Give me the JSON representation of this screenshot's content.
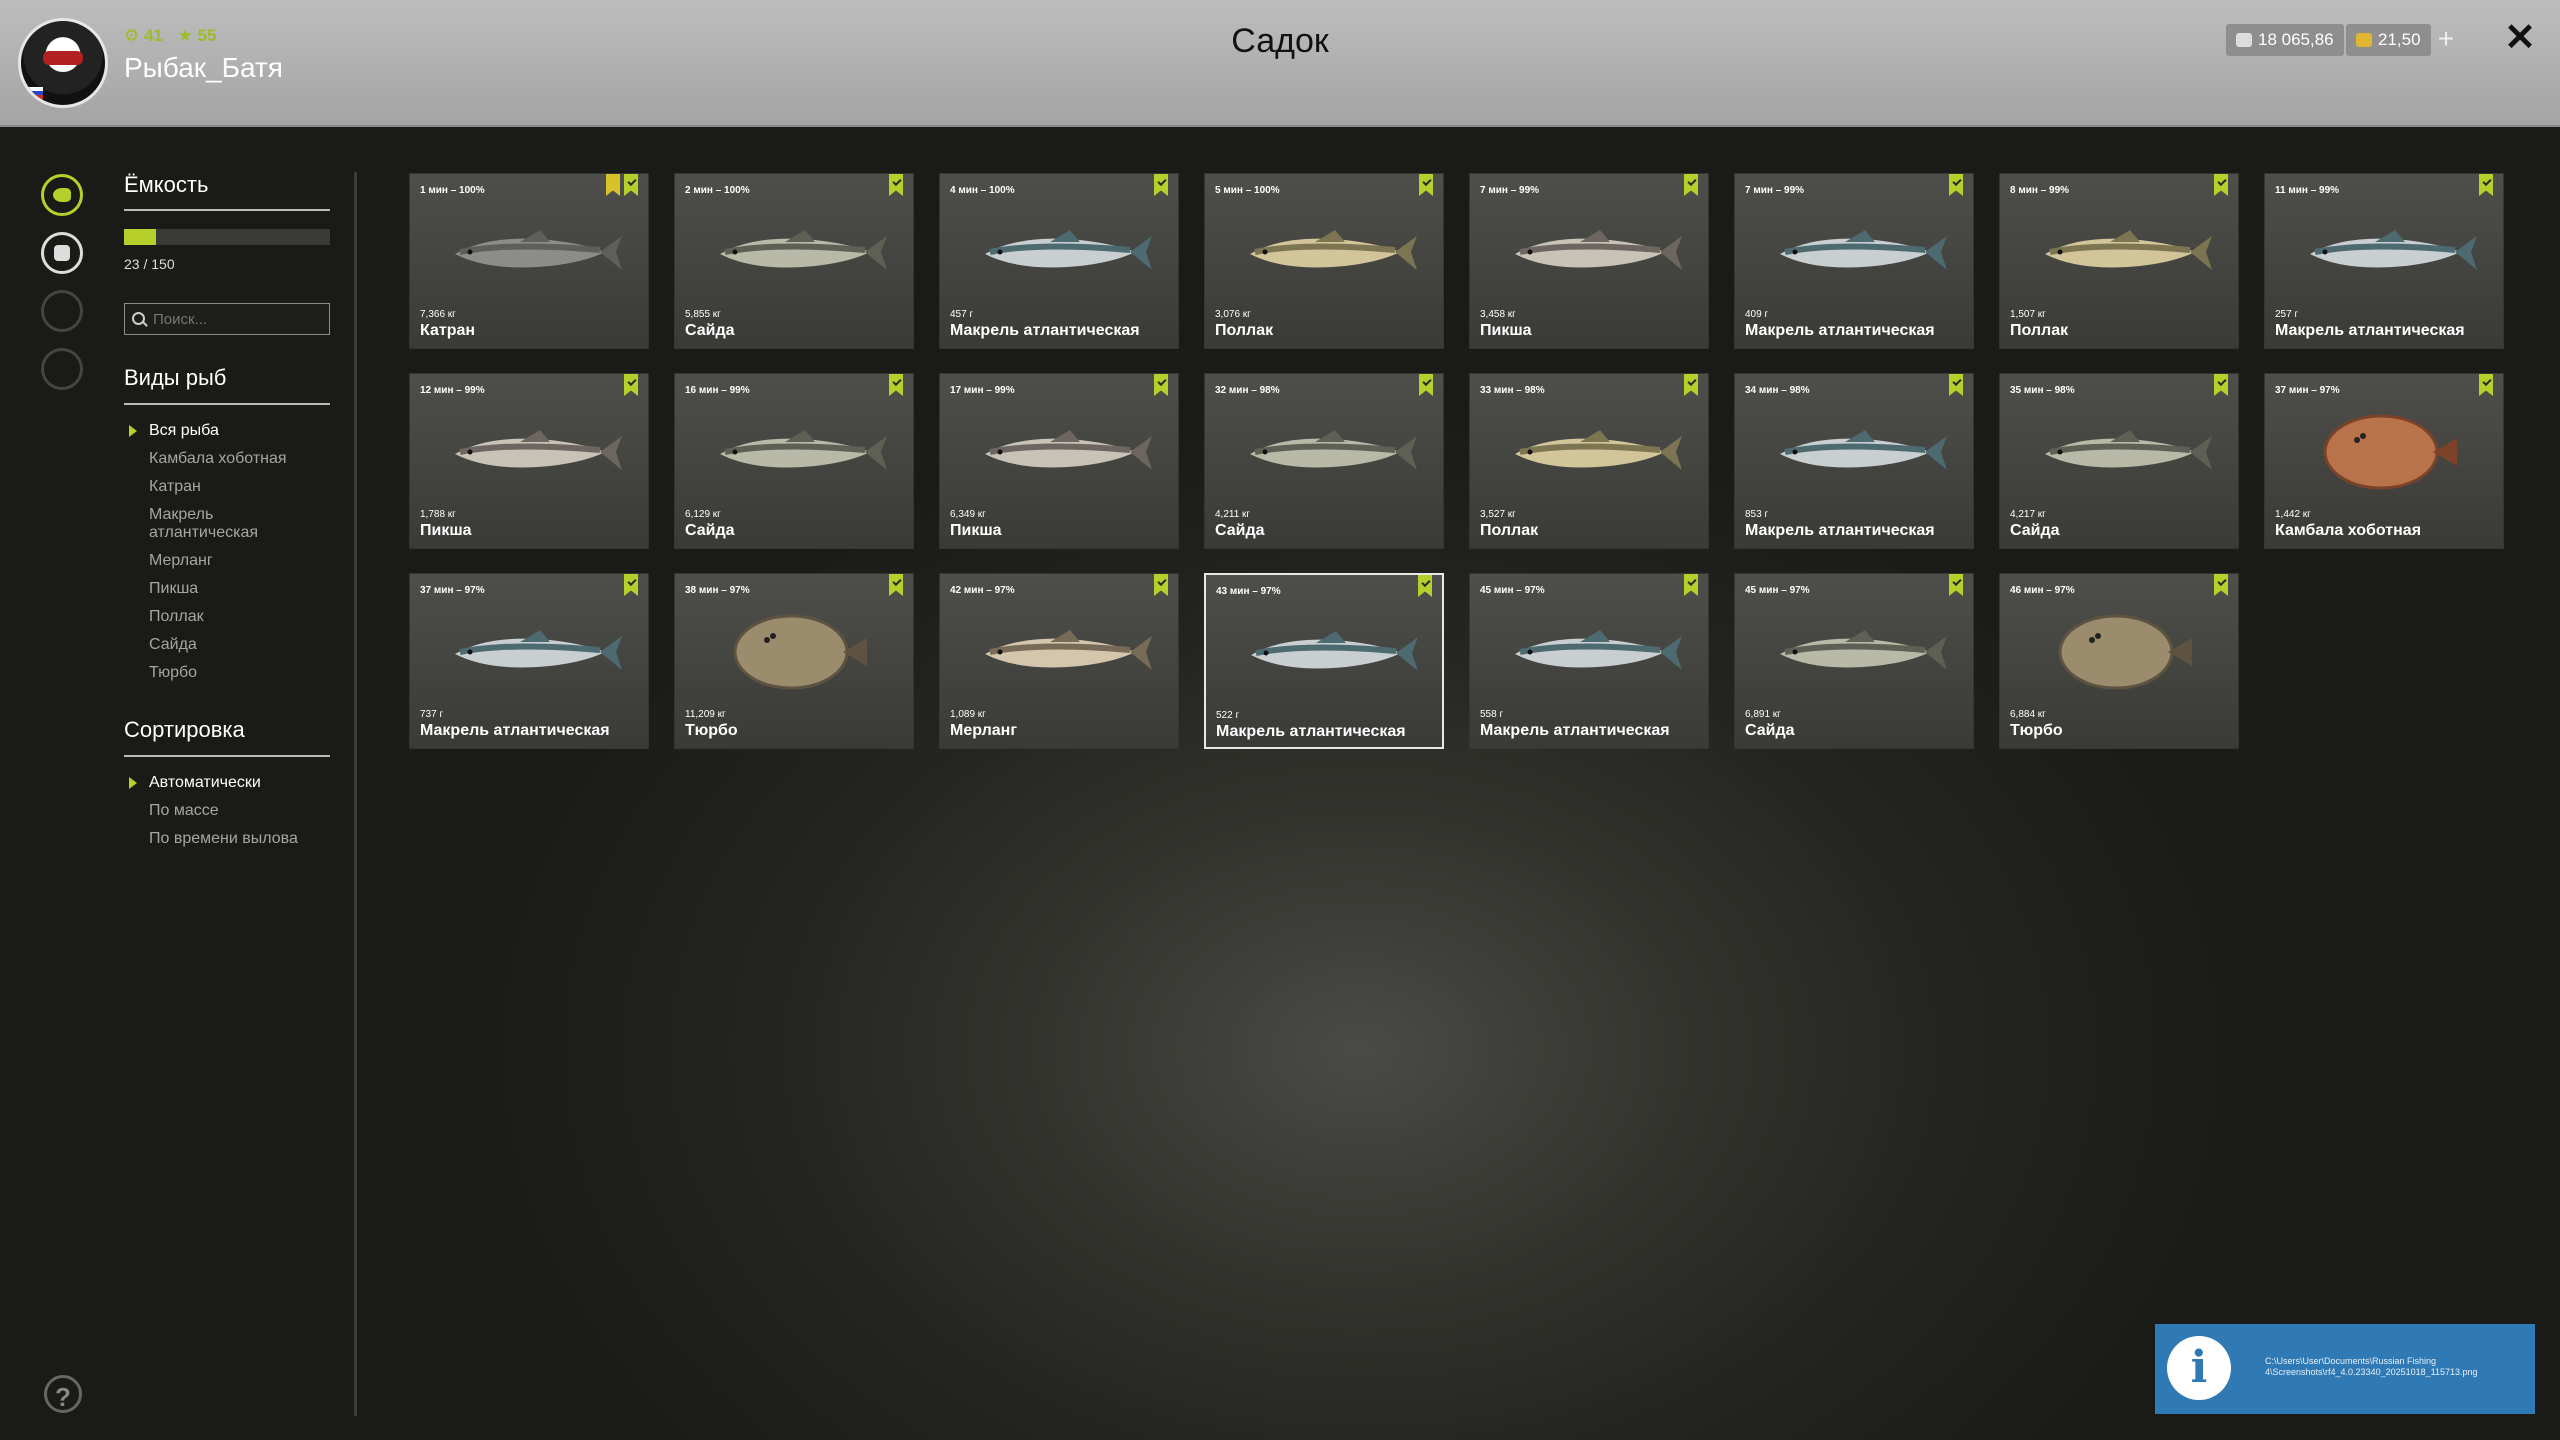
{
  "header": {
    "title": "Садок",
    "player": {
      "name": "Рыбак_Батя",
      "level": "41",
      "rating": "55"
    },
    "currency": {
      "silver": "18 065,86",
      "gold": "21,50"
    }
  },
  "sidebar": {
    "icons": [
      "fish-keepnet-icon",
      "inventory-icon",
      "fire-icon",
      "home-icon"
    ]
  },
  "capacity": {
    "title": "Ёмкость",
    "text": "23 / 150",
    "fill": 0.153
  },
  "search": {
    "placeholder": "Поиск..."
  },
  "species": {
    "title": "Виды рыб",
    "items": [
      "Вся рыба",
      "Камбала хоботная",
      "Катран",
      "Макрель атлантическая",
      "Мерланг",
      "Пикша",
      "Поллак",
      "Сайда",
      "Тюрбо"
    ],
    "selected": 0
  },
  "sorting": {
    "title": "Сортировка",
    "items": [
      "Автоматически",
      "По массе",
      "По времени вылова"
    ],
    "selected": 0
  },
  "fish": [
    {
      "meta": "1 мин – 100%",
      "weight": "7,366 кг",
      "name": "Катран",
      "kind": "shark",
      "star": true
    },
    {
      "meta": "2 мин – 100%",
      "weight": "5,855 кг",
      "name": "Сайда",
      "kind": "cod"
    },
    {
      "meta": "4 мин – 100%",
      "weight": "457 г",
      "name": "Макрель атлантическая",
      "kind": "mackerel"
    },
    {
      "meta": "5 мин – 100%",
      "weight": "3,076 кг",
      "name": "Поллак",
      "kind": "pollack"
    },
    {
      "meta": "7 мин – 99%",
      "weight": "3,458 кг",
      "name": "Пикша",
      "kind": "haddock"
    },
    {
      "meta": "7 мин – 99%",
      "weight": "409 г",
      "name": "Макрель атлантическая",
      "kind": "mackerel"
    },
    {
      "meta": "8 мин – 99%",
      "weight": "1,507 кг",
      "name": "Поллак",
      "kind": "pollack"
    },
    {
      "meta": "11 мин – 99%",
      "weight": "257 г",
      "name": "Макрель атлантическая",
      "kind": "mackerel"
    },
    {
      "meta": "12 мин – 99%",
      "weight": "1,788 кг",
      "name": "Пикша",
      "kind": "haddock"
    },
    {
      "meta": "16 мин – 99%",
      "weight": "6,129 кг",
      "name": "Сайда",
      "kind": "cod"
    },
    {
      "meta": "17 мин – 99%",
      "weight": "6,349 кг",
      "name": "Пикша",
      "kind": "haddock"
    },
    {
      "meta": "32 мин – 98%",
      "weight": "4,211 кг",
      "name": "Сайда",
      "kind": "cod"
    },
    {
      "meta": "33 мин – 98%",
      "weight": "3,527 кг",
      "name": "Поллак",
      "kind": "pollack"
    },
    {
      "meta": "34 мин – 98%",
      "weight": "853 г",
      "name": "Макрель атлантическая",
      "kind": "mackerel"
    },
    {
      "meta": "35 мин – 98%",
      "weight": "4,217 кг",
      "name": "Сайда",
      "kind": "cod"
    },
    {
      "meta": "37 мин – 97%",
      "weight": "1,442 кг",
      "name": "Камбала хоботная",
      "kind": "flounder"
    },
    {
      "meta": "37 мин – 97%",
      "weight": "737 г",
      "name": "Макрель атлантическая",
      "kind": "mackerel"
    },
    {
      "meta": "38 мин – 97%",
      "weight": "11,209 кг",
      "name": "Тюрбо",
      "kind": "turbot"
    },
    {
      "meta": "42 мин – 97%",
      "weight": "1,089 кг",
      "name": "Мерланг",
      "kind": "whiting"
    },
    {
      "meta": "43 мин – 97%",
      "weight": "522 г",
      "name": "Макрель атлантическая",
      "kind": "mackerel",
      "highlight": true
    },
    {
      "meta": "45 мин – 97%",
      "weight": "558 г",
      "name": "Макрель атлантическая",
      "kind": "mackerel"
    },
    {
      "meta": "45 мин – 97%",
      "weight": "6,891 кг",
      "name": "Сайда",
      "kind": "cod"
    },
    {
      "meta": "46 мин – 97%",
      "weight": "6,884 кг",
      "name": "Тюрбо",
      "kind": "turbot"
    }
  ],
  "colors": {
    "accent": "#b7cf2a",
    "header": "#b0b0b0",
    "toast": "#2f79b4"
  },
  "toast": {
    "path": "C:\\Users\\User\\Documents\\Russian Fishing 4\\Screenshots\\rf4_4.0.23340_20251018_115713.png"
  }
}
